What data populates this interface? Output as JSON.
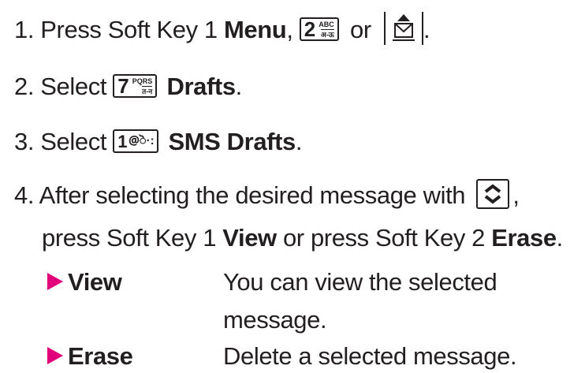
{
  "steps": [
    {
      "num": "1.",
      "pre": "Press Soft Key 1 ",
      "bold": "Menu",
      "comma": ",",
      "key_digit": "2",
      "key_top": "ABC",
      "key_bottom": "अ-ऊ",
      "mid": "or",
      "end": "."
    },
    {
      "num": "2.",
      "pre": "Select",
      "key_digit": "7",
      "key_top": "PQRS",
      "key_bottom": "त-न",
      "bold": "Drafts",
      "end": "."
    },
    {
      "num": "3.",
      "pre": "Select",
      "key_digit": "1",
      "key_syms": "@ॆ·:",
      "bold": "SMS Drafts",
      "end": "."
    },
    {
      "num": "4.",
      "line1": "After selecting the desired message with",
      "line1_end": ",",
      "line2_pre": "press Soft Key 1 ",
      "line2_bold1": "View",
      "line2_mid": " or press Soft Key 2 ",
      "line2_bold2": "Erase",
      "line2_end": "."
    }
  ],
  "options": [
    {
      "term": "View",
      "desc1": "You can view the selected",
      "desc2": "message."
    },
    {
      "term": "Erase",
      "desc1": "Delete a selected message."
    }
  ],
  "colors": {
    "text": "#231f20",
    "arrow": "#e2007a"
  },
  "icons": [
    "key-2-icon",
    "message-envelope-icon",
    "key-7-icon",
    "key-1-icon",
    "nav-up-down-icon",
    "triangle-bullet-icon"
  ]
}
